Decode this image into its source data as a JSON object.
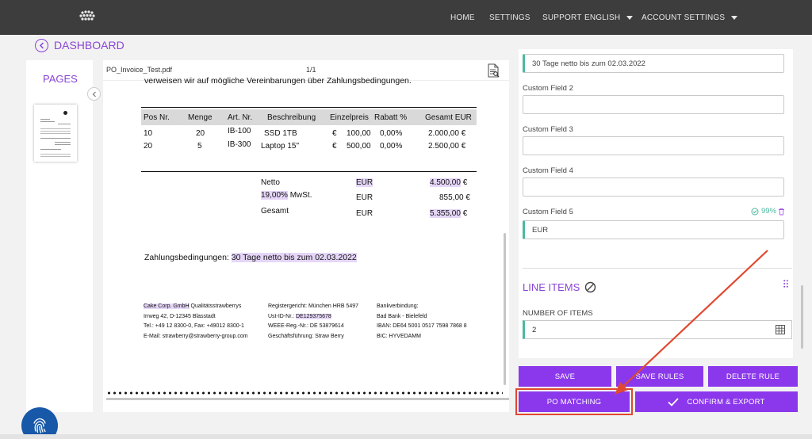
{
  "nav": {
    "home": "HOME",
    "settings": "SETTINGS",
    "support": "SUPPORT",
    "language": "ENGLISH",
    "account_settings": "ACCOUNT SETTINGS"
  },
  "dashboard_label": "DASHBOARD",
  "pages_title": "PAGES",
  "viewer": {
    "filename": "PO_Invoice_Test.pdf",
    "page_count": "1/1"
  },
  "document": {
    "cut_text": "verweisen wir auf mögliche Vereinbarungen über Zahlungsbedingungen.",
    "table_headers": [
      "Pos Nr.",
      "Menge",
      "Art. Nr.",
      "Beschreibung",
      "Einzelpreis",
      "Rabatt %",
      "Gesamt EUR"
    ],
    "rows": [
      {
        "pos": "10",
        "menge": "20",
        "art": "IB-100",
        "desc": "SSD 1TB",
        "cur": "€",
        "price": "100,00",
        "rabatt": "0,00%",
        "total": "2.000,00 €"
      },
      {
        "pos": "20",
        "menge": "5",
        "art": "IB-300",
        "desc": "Laptop 15\"",
        "cur": "€",
        "price": "500,00",
        "rabatt": "0,00%",
        "total": "2.500,00 €"
      }
    ],
    "netto_label": "Netto",
    "netto_cur": "EUR",
    "netto_value": "4.500,00",
    "mwst_pct": "19,00%",
    "mwst_label": " MwSt.",
    "mwst_cur": "EUR",
    "mwst_value": "855,00 €",
    "gesamt_label": "Gesamt",
    "gesamt_cur": "EUR",
    "gesamt_value": "5.355,00",
    "euro": "€",
    "zahlung_label": "Zahlungsbedingungen: ",
    "zahlung_value": "30 Tage netto bis zum 02.03.2022",
    "footer_col1": {
      "company": "Cake Corp. GmbH",
      "company_rest": " Qualitätsstrawberrys",
      "line2": "Irrweg 42, D-12345 Blasstadt",
      "line3": "Tel.: +49 12 8300-0, Fax: +49012 8300-1",
      "line4": "E-Mail: strawberry@strawberry-group.com"
    },
    "footer_col2": {
      "line1": "Registergericht: München HRB 5497",
      "line2_label": "Ust-ID-Nr.: ",
      "line2_value": "DE129375678",
      "line3": "WEEE-Reg.-Nr.: DE 53879614",
      "line4": "Geschäftsführung: Straw Berry"
    },
    "footer_col3": {
      "line1": "Bankverbindung:",
      "line2": "Bad Bank - Bielefeld",
      "line3": "IBAN: DE64 5001 0517 7598 7868 8",
      "line4": "BIC: HYVEDAMM"
    }
  },
  "panel": {
    "top_field_value": "30 Tage netto bis zum 02.03.2022",
    "custom2_label": "Custom Field 2",
    "custom3_label": "Custom Field 3",
    "custom4_label": "Custom Field 4",
    "custom5_label": "Custom Field 5",
    "custom5_confidence": "99%",
    "custom5_value": "EUR",
    "line_items_title": "LINE ITEMS",
    "number_of_items_label": "NUMBER OF ITEMS",
    "number_of_items_value": "2"
  },
  "buttons": {
    "save": "SAVE",
    "save_rules": "SAVE RULES",
    "delete_rule": "DELETE RULE",
    "po_matching": "PO MATCHING",
    "confirm_export": "CONFIRM & EXPORT"
  },
  "colors": {
    "accent": "#8b38ec",
    "highlight": "#e5d6f8",
    "success": "#4bb89f",
    "annotation": "#e0482f",
    "nav_bg": "#3d3d3d"
  }
}
